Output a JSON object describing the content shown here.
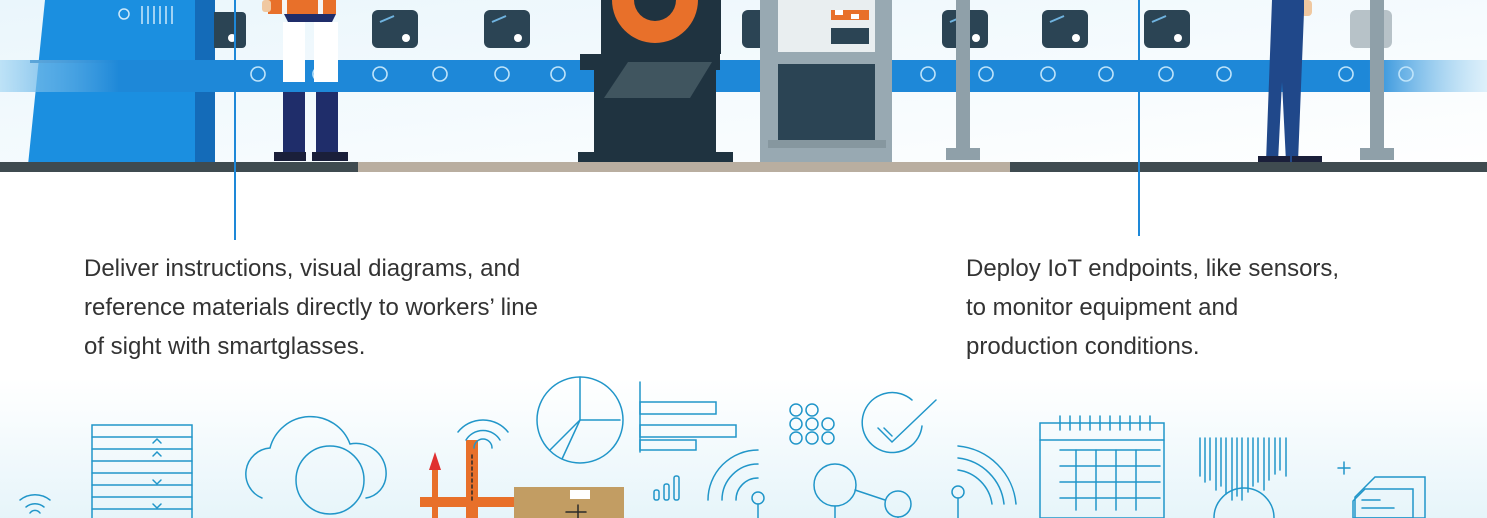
{
  "callouts": {
    "left": {
      "line1": "Deliver instructions, visual diagrams, and",
      "line2": "reference materials directly to workers’ line",
      "line3": "of sight with smartglasses."
    },
    "right": {
      "line1": "Deploy IoT endpoints, like sensors,",
      "line2": "to monitor equipment and",
      "line3": "production conditions."
    }
  },
  "colors": {
    "belt_blue": "#1e88d8",
    "machine_navy": "#1f3340",
    "accent_orange": "#e8702a",
    "outline_blue": "#2196c9",
    "floor_dark": "#3f4b50",
    "floor_tan": "#b9aea0"
  },
  "icons": [
    "wifi-icon",
    "server-rack-icon",
    "cloud-search-icon",
    "crane-icon",
    "barcode-package-icon",
    "pie-chart-icon",
    "bar-chart-icon",
    "signal-bars-icon",
    "wireless-node-icon",
    "dot-grid-icon",
    "checkmark-circle-icon",
    "network-nodes-icon",
    "calendar-icon",
    "barcode-icon",
    "document-icon"
  ]
}
